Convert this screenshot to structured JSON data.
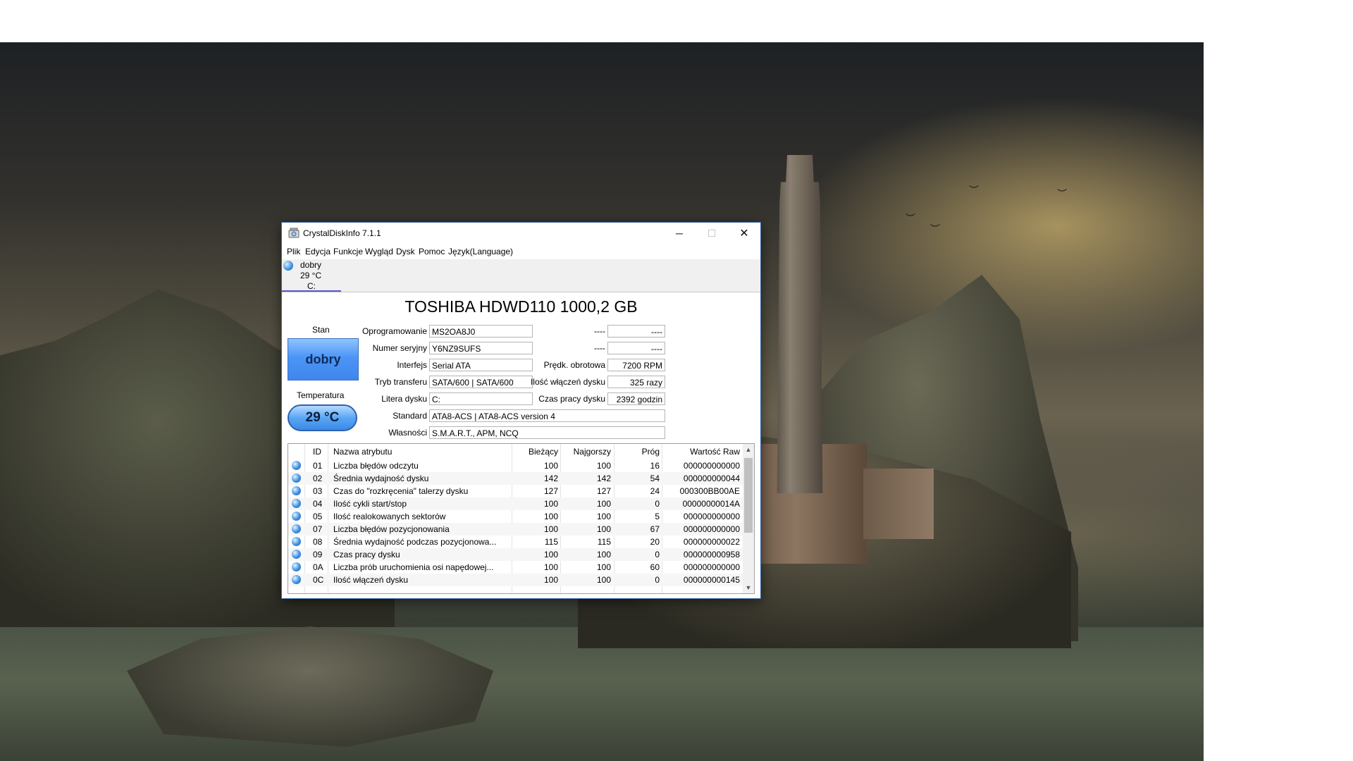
{
  "window": {
    "title": "CrystalDiskInfo 7.1.1",
    "minimize_glyph": "─",
    "maximize_glyph": "☐",
    "close_glyph": "✕"
  },
  "menu": [
    "Plik",
    "Edycja",
    "Funkcje",
    "Wygląd",
    "Dysk",
    "Pomoc",
    "Język(Language)"
  ],
  "drive_tab": {
    "status": "dobry",
    "temperature": "29 °C",
    "letter": "C:"
  },
  "disk_title": "TOSHIBA HDWD110 1000,2 GB",
  "health": {
    "label": "Stan",
    "value": "dobry",
    "temp_label": "Temperatura",
    "temp_value": "29 °C"
  },
  "info_left": [
    {
      "label": "Oprogramowanie",
      "value": "MS2OA8J0"
    },
    {
      "label": "Numer seryjny",
      "value": "Y6NZ9SUFS"
    },
    {
      "label": "Interfejs",
      "value": "Serial ATA"
    },
    {
      "label": "Tryb transferu",
      "value": "SATA/600 | SATA/600"
    },
    {
      "label": "Litera dysku",
      "value": "C:"
    }
  ],
  "info_right": [
    {
      "label": "----",
      "value": "----"
    },
    {
      "label": "----",
      "value": "----"
    },
    {
      "label": "Prędk. obrotowa",
      "value": "7200 RPM"
    },
    {
      "label": "Ilość włączeń dysku",
      "value": "325 razy"
    },
    {
      "label": "Czas pracy dysku",
      "value": "2392 godzin"
    }
  ],
  "info_wide": [
    {
      "label": "Standard",
      "value": "ATA8-ACS | ATA8-ACS version 4"
    },
    {
      "label": "Własności",
      "value": "S.M.A.R.T., APM, NCQ"
    }
  ],
  "smart_headers": [
    "ID",
    "Nazwa atrybutu",
    "Bieżący",
    "Najgorszy",
    "Próg",
    "Wartość Raw"
  ],
  "smart_rows": [
    {
      "id": "01",
      "name": "Liczba błędów odczytu",
      "current": "100",
      "worst": "100",
      "threshold": "16",
      "raw": "000000000000"
    },
    {
      "id": "02",
      "name": "Średnia wydajność dysku",
      "current": "142",
      "worst": "142",
      "threshold": "54",
      "raw": "000000000044"
    },
    {
      "id": "03",
      "name": "Czas do \"rozkręcenia\" talerzy dysku",
      "current": "127",
      "worst": "127",
      "threshold": "24",
      "raw": "000300BB00AE"
    },
    {
      "id": "04",
      "name": "Ilość cykli start/stop",
      "current": "100",
      "worst": "100",
      "threshold": "0",
      "raw": "00000000014A"
    },
    {
      "id": "05",
      "name": "Ilość realokowanych sektorów",
      "current": "100",
      "worst": "100",
      "threshold": "5",
      "raw": "000000000000"
    },
    {
      "id": "07",
      "name": "Liczba błędów pozycjonowania",
      "current": "100",
      "worst": "100",
      "threshold": "67",
      "raw": "000000000000"
    },
    {
      "id": "08",
      "name": "Średnia wydajność podczas pozycjonowa...",
      "current": "115",
      "worst": "115",
      "threshold": "20",
      "raw": "000000000022"
    },
    {
      "id": "09",
      "name": "Czas pracy dysku",
      "current": "100",
      "worst": "100",
      "threshold": "0",
      "raw": "000000000958"
    },
    {
      "id": "0A",
      "name": "Liczba prób uruchomienia osi napędowej...",
      "current": "100",
      "worst": "100",
      "threshold": "60",
      "raw": "000000000000"
    },
    {
      "id": "0C",
      "name": "Ilość włączeń dysku",
      "current": "100",
      "worst": "100",
      "threshold": "0",
      "raw": "000000000145"
    }
  ],
  "colors": {
    "health_good": "#4b95f5",
    "status_dot": "#3e90e2",
    "drive_tab_underline": "#5a57c7"
  },
  "icons": {
    "app": "crystaldiskinfo-icon",
    "status": "good-status-dot-icon"
  }
}
